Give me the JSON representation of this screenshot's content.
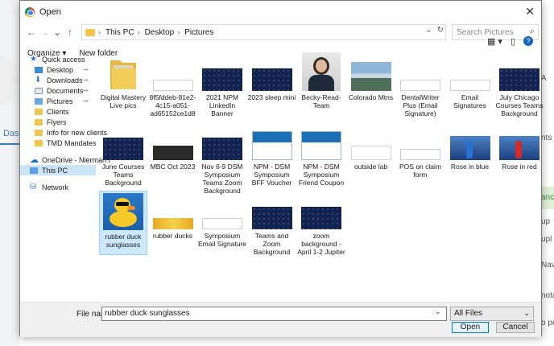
{
  "background": {
    "left_tab": "Das",
    "right_texts": [
      "A",
      "nts",
      "ance",
      "up",
      "upl",
      "Navi",
      "nota",
      "o per"
    ]
  },
  "dialog": {
    "title": "Open",
    "close_glyph": "✕"
  },
  "navigation": {
    "back": "←",
    "forward": "→",
    "recent": "⌄",
    "up": "↑",
    "breadcrumb": [
      "This PC",
      "Desktop",
      "Pictures"
    ],
    "breadcrumb_sep": "›",
    "address_dropdown": "⌄",
    "refresh": "↻",
    "search_placeholder": "Search Pictures",
    "search_icon": "⌕"
  },
  "toolbar": {
    "organize_label": "Organize ▾",
    "new_folder_label": "New folder",
    "view_icon": "▦ ▾",
    "pane_icon": "▯",
    "help_icon": "?"
  },
  "sidebar": {
    "items": [
      {
        "label": "Quick access",
        "icon": "star-icon",
        "pinned": false
      },
      {
        "label": "Desktop",
        "icon": "desktop-icon",
        "pinned": true
      },
      {
        "label": "Downloads",
        "icon": "downloads-icon",
        "pinned": true
      },
      {
        "label": "Documents",
        "icon": "documents-icon",
        "pinned": true
      },
      {
        "label": "Pictures",
        "icon": "pictures-icon",
        "pinned": true
      },
      {
        "label": "Clients",
        "icon": "folder-icon",
        "pinned": false
      },
      {
        "label": "Flyers",
        "icon": "folder-icon",
        "pinned": false
      },
      {
        "label": "Info for new clients",
        "icon": "folder-icon",
        "pinned": false
      },
      {
        "label": "TMD Mandates",
        "icon": "folder-icon",
        "pinned": false
      },
      {
        "label": "OneDrive - Nierman I",
        "icon": "onedrive-icon",
        "pinned": false
      },
      {
        "label": "This PC",
        "icon": "this-pc-icon",
        "pinned": false,
        "selected": true
      },
      {
        "label": "Network",
        "icon": "network-icon",
        "pinned": false
      }
    ],
    "pin_glyph": "📌"
  },
  "files": [
    {
      "name": "Digital Mastery Live pics",
      "thumb": "folder",
      "selected": false
    },
    {
      "name": "8f5fddeb-81e2-4c15-a051-ad65152ce1d8",
      "thumb": "white",
      "selected": false
    },
    {
      "name": "2021 NPM LinkedIn Banner",
      "thumb": "navy",
      "selected": false
    },
    {
      "name": "2023 sleep mini",
      "thumb": "navy",
      "selected": false
    },
    {
      "name": "Becky-Read-Team",
      "thumb": "woman",
      "selected": false
    },
    {
      "name": "Colorado Mtns",
      "thumb": "mountain",
      "selected": false
    },
    {
      "name": "DentalWriter Plus (Email Signature)",
      "thumb": "white",
      "selected": false
    },
    {
      "name": "Email Signatures",
      "thumb": "white",
      "selected": false
    },
    {
      "name": "July Chicago Courses Teams Background",
      "thumb": "navy",
      "selected": false
    },
    {
      "name": "June Courses Teams Background",
      "thumb": "navy",
      "selected": false
    },
    {
      "name": "MBC Oct 2023",
      "thumb": "dark",
      "selected": false
    },
    {
      "name": "Nov 6-9 DSM Symposium Teams Zoom Background",
      "thumb": "navy",
      "selected": false
    },
    {
      "name": "NPM - DSM Symposium BFF Voucher",
      "thumb": "coupon",
      "selected": false
    },
    {
      "name": "NPM - DSM Symposium Friend Coupon",
      "thumb": "coupon",
      "selected": false
    },
    {
      "name": "outside lab",
      "thumb": "pink",
      "selected": false
    },
    {
      "name": "POS on claim form",
      "thumb": "white",
      "selected": false
    },
    {
      "name": "Rose in blue",
      "thumb": "stage",
      "selected": false
    },
    {
      "name": "Rose in red",
      "thumb": "stage",
      "selected": false
    },
    {
      "name": "rubber duck sunglasses",
      "thumb": "duck",
      "selected": true
    },
    {
      "name": "rubber ducks",
      "thumb": "gold",
      "selected": false
    },
    {
      "name": "Symposium Email Signature",
      "thumb": "white",
      "selected": false
    },
    {
      "name": "Teams and Zoom Background",
      "thumb": "navy",
      "selected": false
    },
    {
      "name": "zoom background - April 1-2 Jupiter",
      "thumb": "navy",
      "selected": false
    }
  ],
  "footer": {
    "file_name_label": "File name:",
    "file_name_value": "rubber duck sunglasses",
    "file_name_dropdown": "⌄",
    "file_type": "All Files",
    "file_type_dropdown": "⌄",
    "open_label": "Open",
    "cancel_label": "Cancel"
  }
}
